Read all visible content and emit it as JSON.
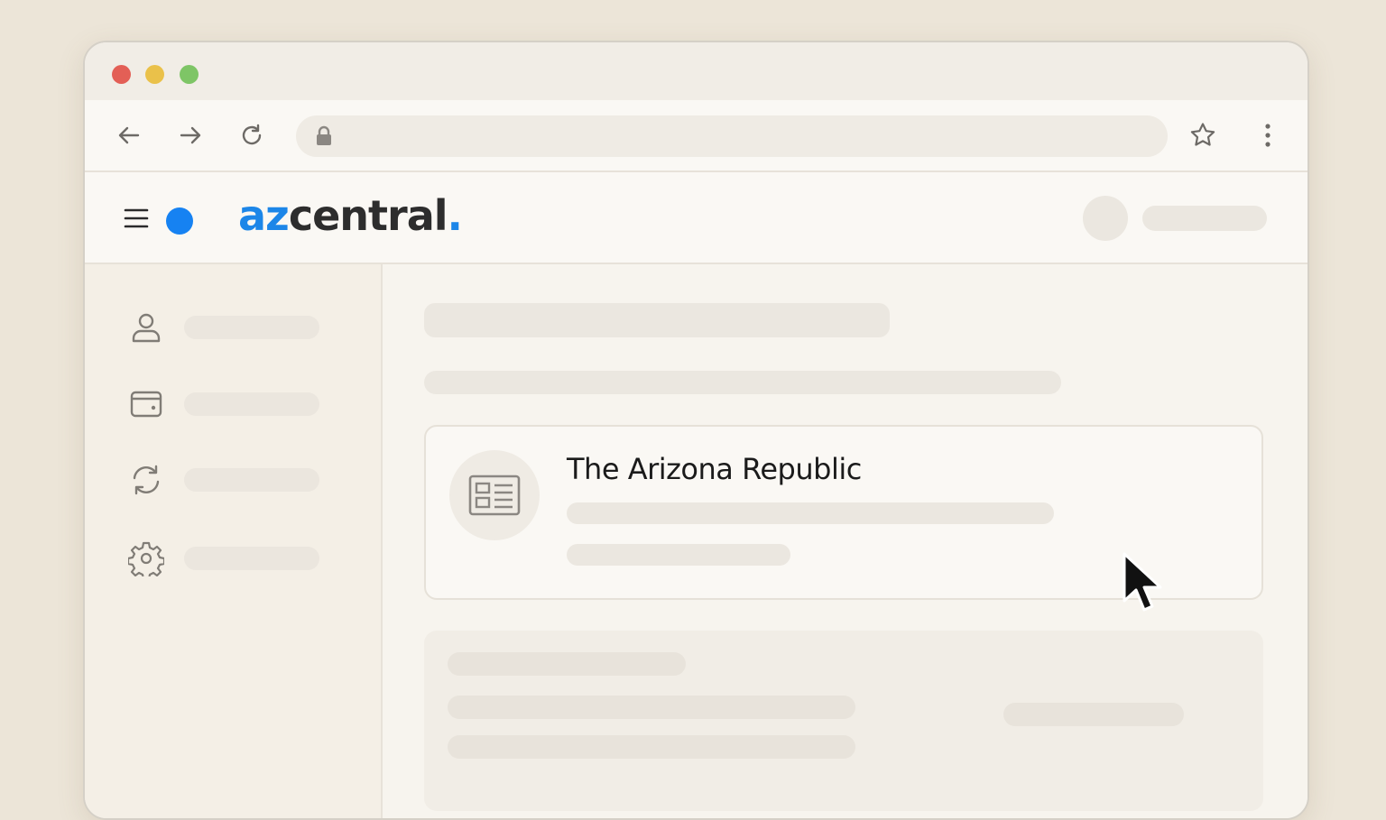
{
  "browser": {
    "url": "",
    "window_controls": [
      "close",
      "minimize",
      "maximize"
    ],
    "toolbar_icons": [
      "back-arrow-icon",
      "forward-arrow-icon",
      "reload-icon",
      "lock-icon",
      "star-icon",
      "kebab-menu-icon"
    ]
  },
  "site": {
    "logo_az": "az",
    "logo_central": "central",
    "logo_period": ".",
    "accent_color": "#1682f2"
  },
  "sidebar": {
    "items": [
      {
        "icon": "user-icon",
        "label": ""
      },
      {
        "icon": "wallet-icon",
        "label": ""
      },
      {
        "icon": "refresh-icon",
        "label": ""
      },
      {
        "icon": "gear-icon",
        "label": ""
      }
    ]
  },
  "main": {
    "card": {
      "title": "The Arizona Republic",
      "icon": "newspaper-icon"
    }
  }
}
